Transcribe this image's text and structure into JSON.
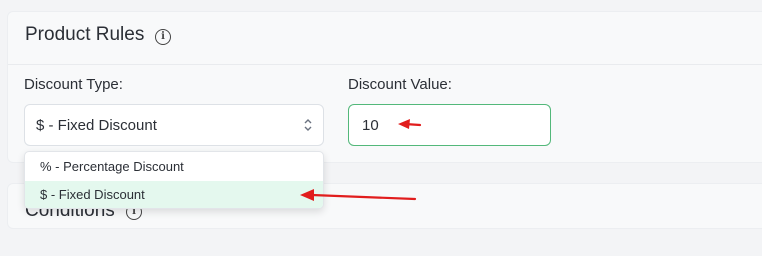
{
  "product_rules": {
    "title": "Product Rules",
    "info_icon": "info-circle-icon",
    "discount_type": {
      "label": "Discount Type:",
      "selected": "$ - Fixed Discount",
      "options": [
        "% - Percentage Discount",
        "$ - Fixed Discount"
      ]
    },
    "discount_value": {
      "label": "Discount Value:",
      "value": "10"
    }
  },
  "conditions": {
    "title": "Conditions",
    "info_icon": "info-circle-icon"
  },
  "colors": {
    "accent_green": "#53b87a",
    "selected_option_bg": "#e4f8ee",
    "annotation_arrow": "#e11d1d"
  }
}
